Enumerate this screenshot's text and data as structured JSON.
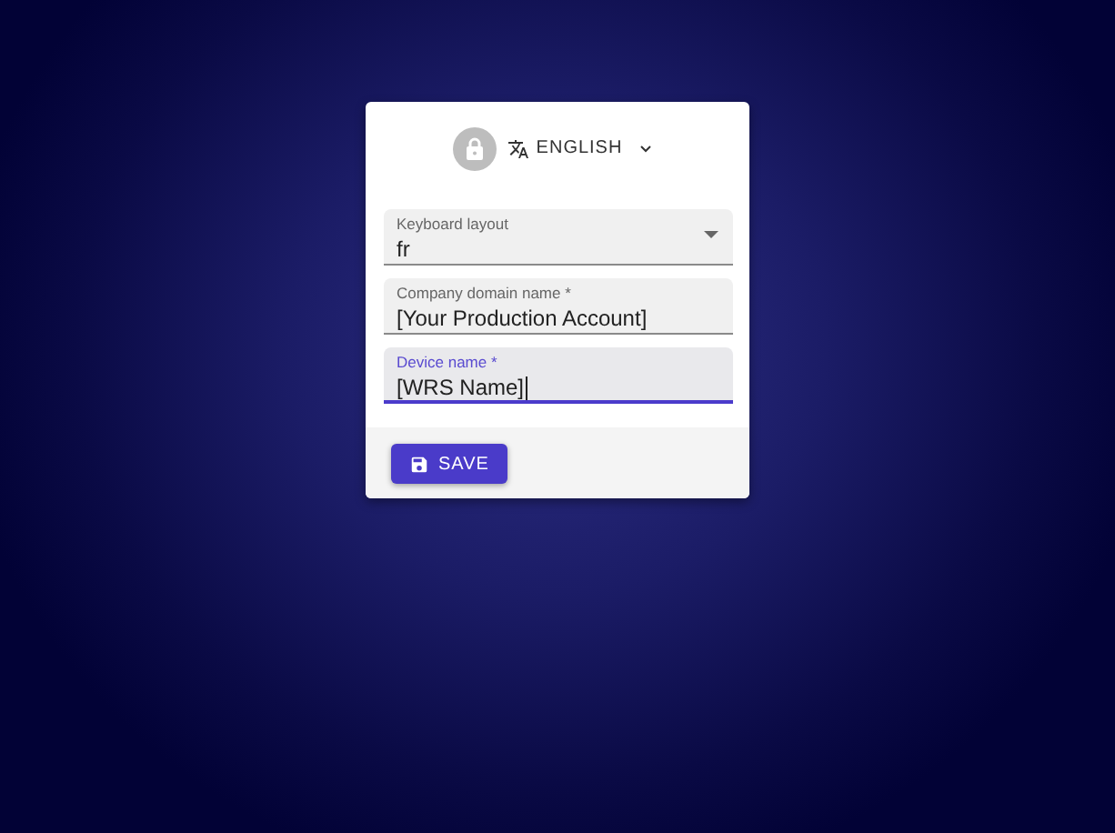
{
  "language": {
    "label": "ENGLISH"
  },
  "fields": [
    {
      "kind": "select",
      "label": "Keyboard layout",
      "value": "fr",
      "focused": false
    },
    {
      "kind": "text",
      "label": "Company domain name *",
      "value": "[Your Production Account]",
      "focused": false
    },
    {
      "kind": "text",
      "label": "Device name *",
      "value": "[WRS Name]",
      "focused": true
    }
  ],
  "save_button": {
    "label": "SAVE"
  }
}
